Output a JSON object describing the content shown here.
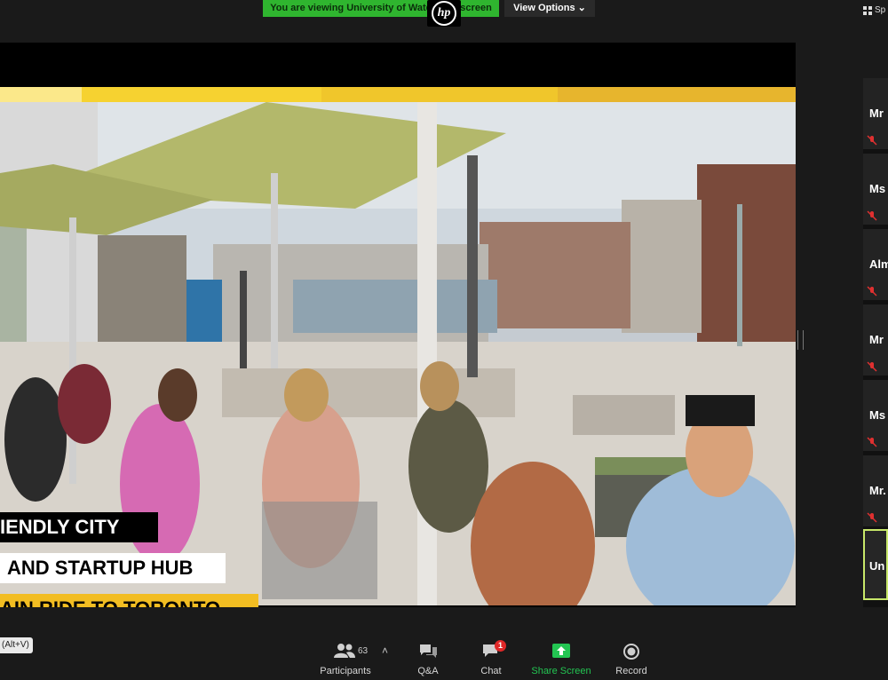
{
  "top": {
    "banner_text": "You are viewing University of Waterloo's screen",
    "view_options_label": "View Options",
    "speaker_view_label": "Sp"
  },
  "colors": {
    "banner_green": "#2fb52f",
    "stripe_yellow": "#f6d230",
    "stripe_gold": "#e7b52d",
    "share_green": "#23c552",
    "active_tile_border": "#c8e86a",
    "badge_red": "#e02828"
  },
  "shared_video": {
    "lower_thirds": [
      "IENDLY CITY",
      "AND STARTUP HUB",
      "AIN RIDE TO TORONTO"
    ]
  },
  "participants_panel": {
    "tiles": [
      {
        "name": "Mr",
        "muted": true
      },
      {
        "name": "Ms",
        "muted": true
      },
      {
        "name": "Alm",
        "muted": true
      },
      {
        "name": "Mr",
        "muted": true
      },
      {
        "name": "Ms",
        "muted": true
      },
      {
        "name": "Mr.",
        "muted": true
      },
      {
        "name": "Un",
        "muted": false,
        "active": true
      }
    ]
  },
  "shortcut_hint": "(Alt+V)",
  "toolbar": {
    "participants_label": "Participants",
    "participants_count": "63",
    "qa_label": "Q&A",
    "chat_label": "Chat",
    "chat_badge": "1",
    "share_label": "Share Screen",
    "record_label": "Record"
  },
  "icons": [
    "hp-logo",
    "grid-icon",
    "mic-muted-icon",
    "participants-icon",
    "caret-up-icon",
    "qa-icon",
    "chat-icon",
    "share-screen-icon",
    "record-icon",
    "chevron-down-icon"
  ]
}
